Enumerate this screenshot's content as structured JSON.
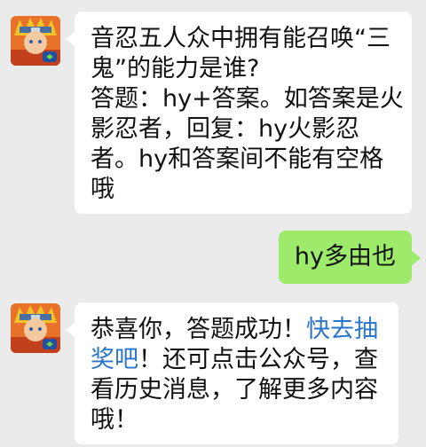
{
  "colors": {
    "background": "#ebebeb",
    "incoming_bubble": "#ffffff",
    "outgoing_bubble": "#9eea6a",
    "link": "#2a74c9"
  },
  "messages": [
    {
      "sender": "bot",
      "avatar_icon": "naruto-avatar-icon",
      "lines": [
        "音忍五人众中拥有能召唤“三",
        "鬼”的能力是谁?",
        "答题：hy+答案。如答案是火",
        "影忍者，回复：hy火影忍",
        "者。hy和答案间不能有空格",
        "哦"
      ]
    },
    {
      "sender": "user",
      "text": "hy多由也"
    },
    {
      "sender": "bot",
      "avatar_icon": "naruto-avatar-icon",
      "line1_text": "恭喜你，答题成功！",
      "line1_link": "快去抽",
      "line2_link": "奖吧",
      "line2_text": "！还可点击公众号，查",
      "line3": "看历史消息，了解更多内容",
      "line4": "哦！"
    }
  ]
}
